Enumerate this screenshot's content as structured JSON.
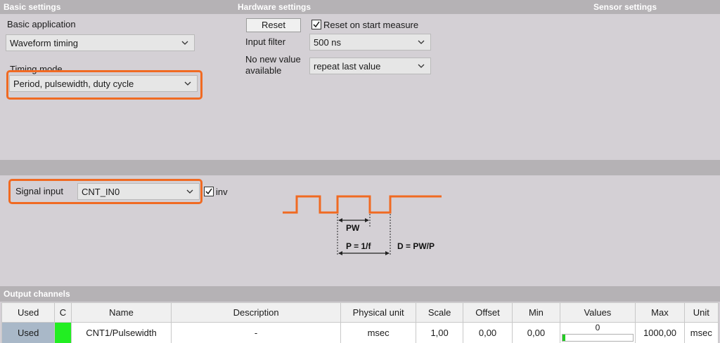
{
  "headers": {
    "basic": "Basic settings",
    "hardware": "Hardware settings",
    "sensor": "Sensor settings",
    "output": "Output channels"
  },
  "basic_settings": {
    "application_label": "Basic application",
    "application_value": "Waveform timing",
    "timing_mode_label": "Timing mode",
    "timing_mode_value": "Period, pulsewidth, duty cycle"
  },
  "hardware_settings": {
    "reset_label": "Reset",
    "reset_on_start_label": "Reset on start measure",
    "reset_on_start_checked": true,
    "input_filter_label": "Input filter",
    "input_filter_value": "500 ns",
    "no_new_value_label_line1": "No new value",
    "no_new_value_label_line2": "available",
    "no_new_value_value": "repeat last value"
  },
  "signal": {
    "input_label": "Signal input",
    "input_value": "CNT_IN0",
    "inv_label": "inv",
    "inv_checked": true
  },
  "diagram": {
    "pw_label": "PW",
    "period_label": "P = 1/f",
    "duty_label": "D = PW/P"
  },
  "output_table": {
    "columns": [
      "Used",
      "C",
      "Name",
      "Description",
      "Physical unit",
      "Scale",
      "Offset",
      "Min",
      "Values",
      "Max",
      "Unit"
    ],
    "rows": [
      {
        "used": "Used",
        "color": "#22ee22",
        "name": "CNT1/Pulsewidth",
        "description": "-",
        "physical_unit": "msec",
        "scale": "1,00",
        "offset": "0,00",
        "min": "0,00",
        "value": "0",
        "max": "1000,00",
        "unit": "msec"
      }
    ]
  },
  "colors": {
    "highlight": "#f06a22",
    "waveform": "#f06a22",
    "header_bg": "#b5b2b5",
    "used_cell_bg": "#a9b8c8",
    "value_bar": "#22cc22"
  }
}
